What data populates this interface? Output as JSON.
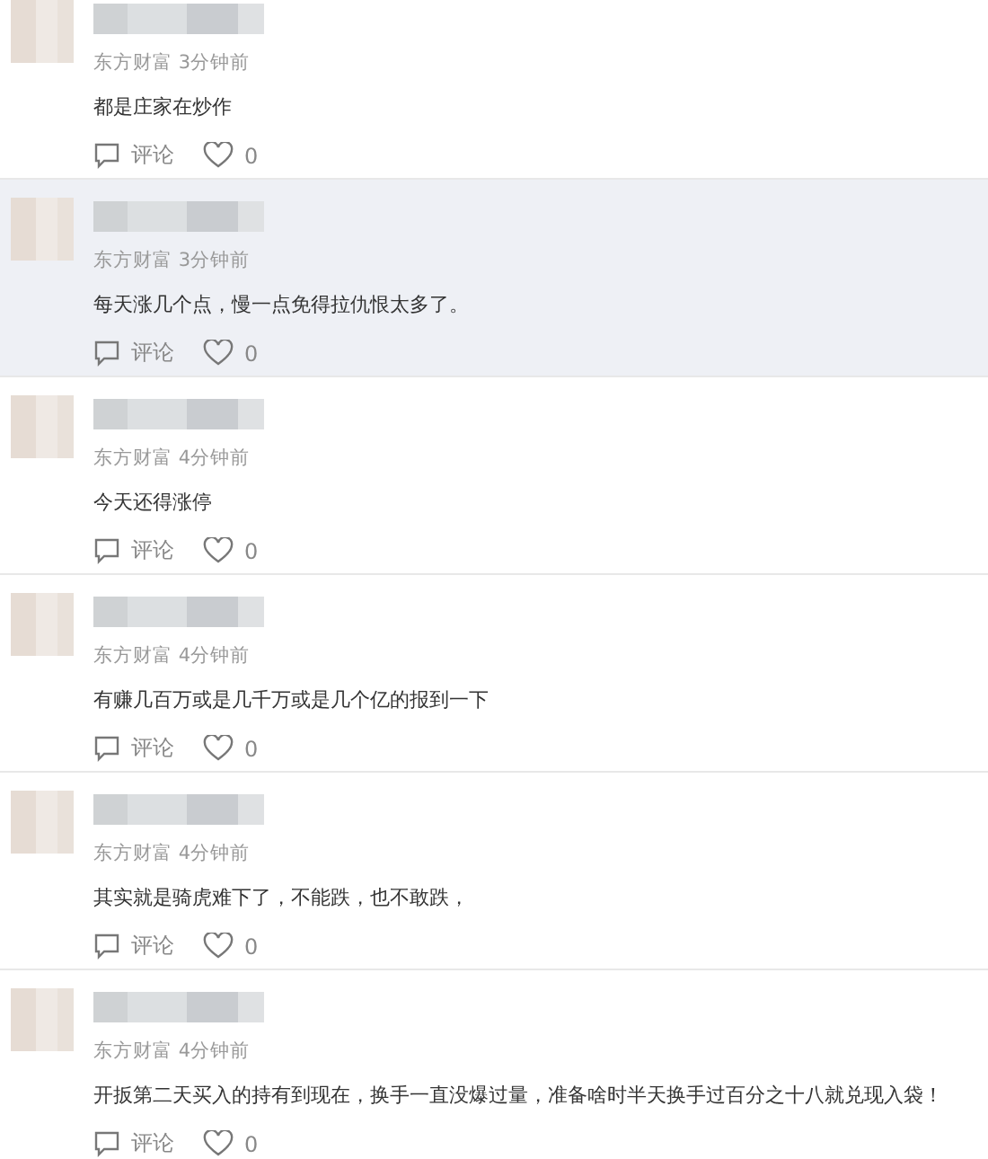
{
  "comments": [
    {
      "source": "东方财富",
      "time": "3分钟前",
      "text": "都是庄家在炒作",
      "reply_label": "评论",
      "likes": "0",
      "highlighted": false
    },
    {
      "source": "东方财富",
      "time": "3分钟前",
      "text": "每天涨几个点，慢一点免得拉仇恨太多了。",
      "reply_label": "评论",
      "likes": "0",
      "highlighted": true
    },
    {
      "source": "东方财富",
      "time": "4分钟前",
      "text": "今天还得涨停",
      "reply_label": "评论",
      "likes": "0",
      "highlighted": false
    },
    {
      "source": "东方财富",
      "time": "4分钟前",
      "text": "有赚几百万或是几千万或是几个亿的报到一下",
      "reply_label": "评论",
      "likes": "0",
      "highlighted": false
    },
    {
      "source": "东方财富",
      "time": "4分钟前",
      "text": "其实就是骑虎难下了，不能跌，也不敢跌，",
      "reply_label": "评论",
      "likes": "0",
      "highlighted": false
    },
    {
      "source": "东方财富",
      "time": "4分钟前",
      "text": "开扳第二天买入的持有到现在，换手一直没爆过量，准备啥时半天换手过百分之十八就兑现入袋！",
      "reply_label": "评论",
      "likes": "0",
      "highlighted": false
    }
  ]
}
